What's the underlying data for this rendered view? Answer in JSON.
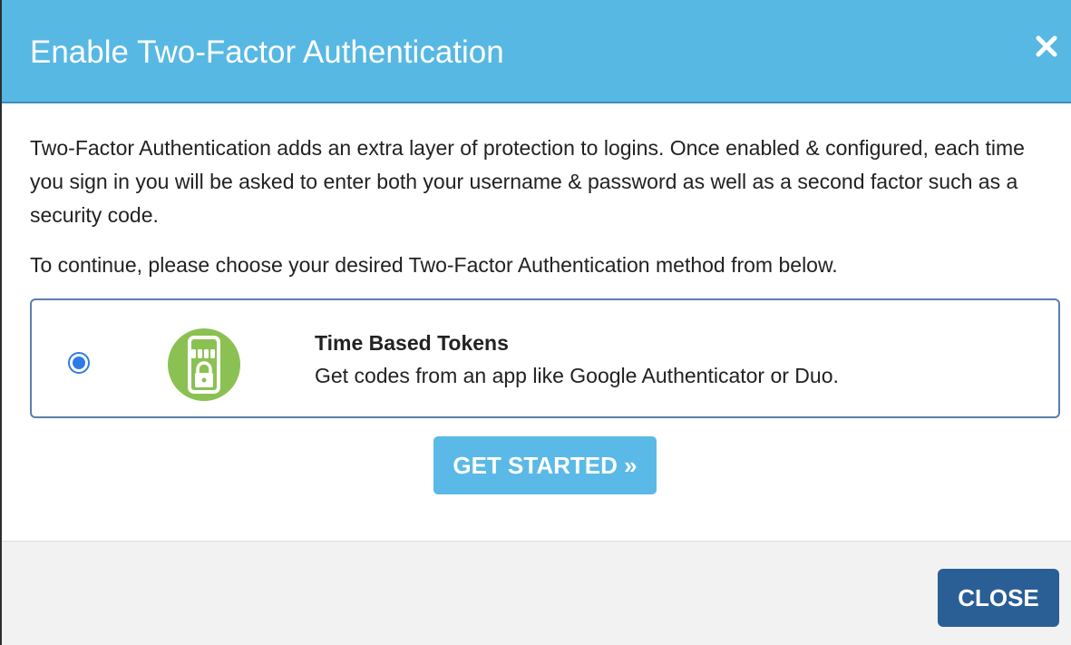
{
  "dialog": {
    "title": "Enable Two-Factor Authentication",
    "header_color": "#57b8e3",
    "close_icon": "close-icon"
  },
  "body": {
    "intro": "Two-Factor Authentication adds an extra layer of protection to logins. Once enabled & configured, each time you sign in you will be asked to enter both your username & password as well as a second factor such as a security code.",
    "instruction": "To continue, please choose your desired Two-Factor Authentication method from below."
  },
  "methods": [
    {
      "title": "Time Based Tokens",
      "description": "Get codes from an app like Google Authenticator or Duo.",
      "selected": true,
      "icon": "phone-lock-icon",
      "icon_color": "#8bc152"
    }
  ],
  "actions": {
    "get_started_label": "GET STARTED »",
    "get_started_color": "#5ab9e6"
  },
  "footer": {
    "close_label": "CLOSE",
    "close_color": "#2a5f96"
  }
}
